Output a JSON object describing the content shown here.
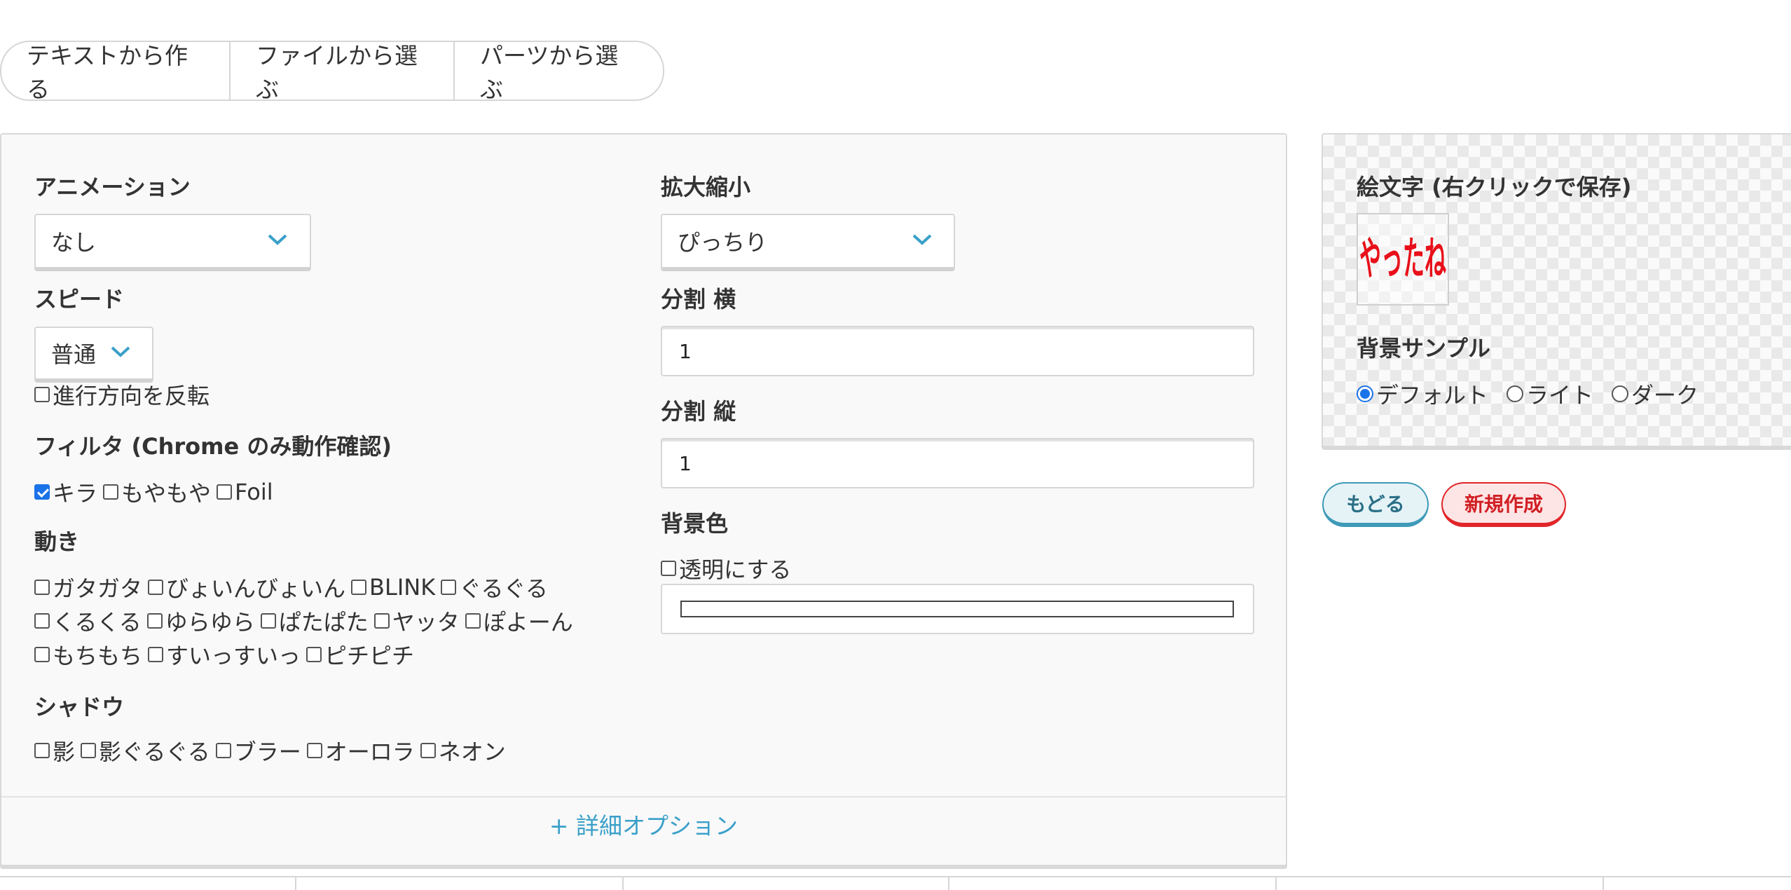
{
  "tabs": [
    {
      "label": "テキストから作る"
    },
    {
      "label": "ファイルから選ぶ"
    },
    {
      "label": "パーツから選ぶ"
    }
  ],
  "left": {
    "animation": {
      "label": "アニメーション",
      "value": "なし"
    },
    "speed": {
      "label": "スピード",
      "value": "普通"
    },
    "reverse": {
      "label": "進行方向を反転",
      "checked": false
    },
    "filter": {
      "label": "フィルタ (Chrome のみ動作確認)",
      "options": [
        {
          "label": "キラ",
          "checked": true
        },
        {
          "label": "もやもや",
          "checked": false
        },
        {
          "label": "Foil",
          "checked": false
        }
      ]
    },
    "motion": {
      "label": "動き",
      "options": [
        {
          "label": "ガタガタ"
        },
        {
          "label": "びょいんびょいん"
        },
        {
          "label": "BLINK"
        },
        {
          "label": "ぐるぐる"
        },
        {
          "label": "くるくる"
        },
        {
          "label": "ゆらゆら"
        },
        {
          "label": "ぱたぱた"
        },
        {
          "label": "ヤッタ"
        },
        {
          "label": "ぽよーん"
        },
        {
          "label": "もちもち"
        },
        {
          "label": "すいっすいっ"
        },
        {
          "label": "ピチピチ"
        }
      ]
    },
    "shadow": {
      "label": "シャドウ",
      "options": [
        {
          "label": "影"
        },
        {
          "label": "影ぐるぐる"
        },
        {
          "label": "ブラー"
        },
        {
          "label": "オーロラ"
        },
        {
          "label": "ネオン"
        }
      ]
    }
  },
  "right": {
    "scale": {
      "label": "拡大縮小",
      "value": "ぴっちり"
    },
    "split_h": {
      "label": "分割 横",
      "value": "1"
    },
    "split_v": {
      "label": "分割 縦",
      "value": "1"
    },
    "bgcolor": {
      "label": "背景色",
      "transparent_label": "透明にする"
    }
  },
  "detail_link": "+ 詳細オプション",
  "preview": {
    "title": "絵文字 (右クリックで保存)",
    "emoji_text": "やったね",
    "emoji_color": "#e8101a",
    "bg_sample": {
      "label": "背景サンプル",
      "options": [
        {
          "label": "デフォルト",
          "checked": true
        },
        {
          "label": "ライト",
          "checked": false
        },
        {
          "label": "ダーク",
          "checked": false
        }
      ]
    }
  },
  "buttons": {
    "back": "もどる",
    "new": "新規作成"
  },
  "colors": {
    "accent": "#3aa0c9",
    "checkbox": "#1a73e8",
    "danger": "#e0262a"
  }
}
